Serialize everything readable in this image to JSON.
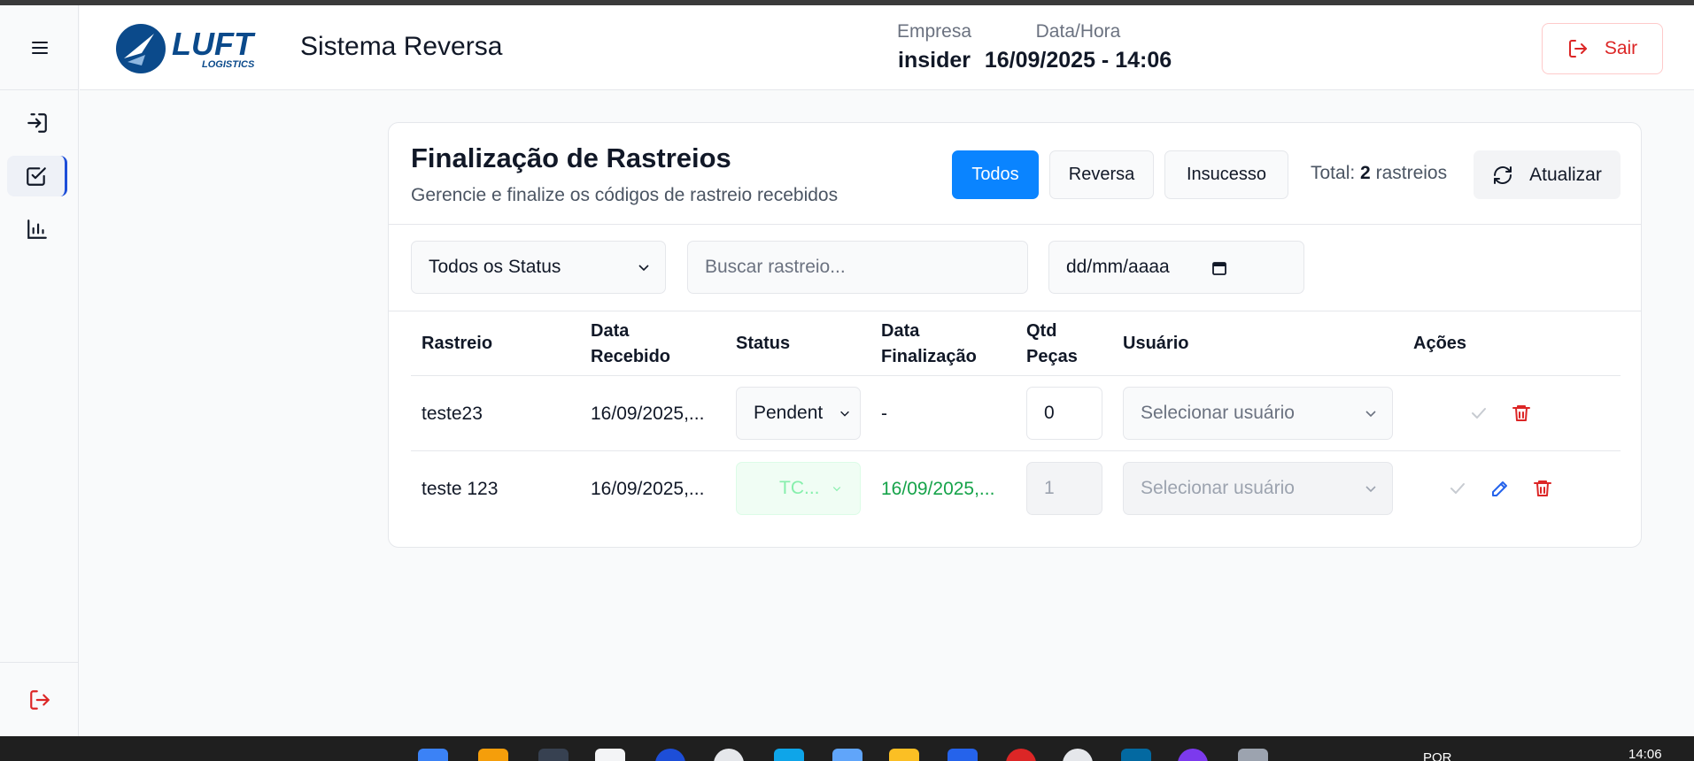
{
  "app": {
    "title": "Sistema Reversa",
    "logo_text": "LUFT",
    "logo_sub": "LOGISTICS"
  },
  "header": {
    "empresa_label": "Empresa",
    "empresa_value": "insider",
    "datahora_label": "Data/Hora",
    "datahora_value": "16/09/2025 - 14:06",
    "logout_label": "Sair"
  },
  "sidebar": {
    "items": [
      {
        "icon": "sign-in-icon"
      },
      {
        "icon": "checkbox-icon",
        "active": true
      },
      {
        "icon": "bar-chart-icon"
      }
    ],
    "logout_icon": "logout-icon"
  },
  "card": {
    "title": "Finalização de Rastreios",
    "subtitle": "Gerencie e finalize os códigos de rastreio recebidos",
    "filters_tabs": [
      "Todos",
      "Reversa",
      "Insucesso"
    ],
    "active_tab": "Todos",
    "total_prefix": "Total:",
    "total_count": "2",
    "total_suffix": "rastreios",
    "refresh_label": "Atualizar"
  },
  "filters": {
    "status_select": "Todos os Status",
    "search_placeholder": "Buscar rastreio...",
    "date_placeholder": "dd/mm/aaaa"
  },
  "table": {
    "headers": {
      "rastreio": "Rastreio",
      "data_recebido_1": "Data",
      "data_recebido_2": "Recebido",
      "status": "Status",
      "data_fin_1": "Data",
      "data_fin_2": "Finalização",
      "qtd_1": "Qtd",
      "qtd_2": "Peças",
      "usuario": "Usuário",
      "acoes": "Ações"
    },
    "rows": [
      {
        "rastreio": "teste23",
        "data_recebido": "16/09/2025,...",
        "status": "Pendent",
        "data_finalizacao": "-",
        "qtd": "0",
        "usuario": "Selecionar usuário"
      },
      {
        "rastreio": "teste 123",
        "data_recebido": "16/09/2025,...",
        "status": "TC...",
        "data_finalizacao": "16/09/2025,...",
        "qtd": "1",
        "usuario": "Selecionar usuário"
      }
    ]
  },
  "taskbar": {
    "lang": "POR",
    "time": "14:06"
  },
  "colors": {
    "primary": "#0a84ff",
    "danger": "#dc2626",
    "success": "#16a34a",
    "brand": "#0b4a8b"
  }
}
